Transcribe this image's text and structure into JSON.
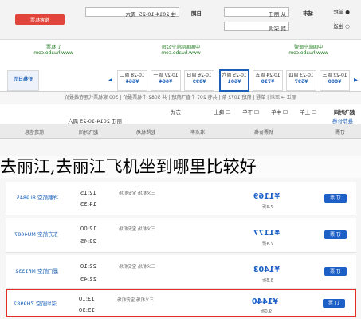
{
  "search": {
    "trip_options": [
      "单程",
      "往返"
    ],
    "from_label": "城市",
    "from_value": "从 丽江",
    "to_value": "到 深圳",
    "date_label": "日期",
    "date_value": "往 2014-10-25",
    "weekday": "周六",
    "cta": "搜索机票"
  },
  "ads": [
    {
      "line1": "中国航空联盟",
      "line2": "www.huabo.com"
    },
    {
      "line1": "中国国际航空公司",
      "line2": "www.huabo.com"
    },
    {
      "line1": "订机票",
      "line2": "www.huabo.com"
    }
  ],
  "date_bar": {
    "cells": [
      {
        "date": "10-22 周三",
        "price": "¥800"
      },
      {
        "date": "10-23 周四",
        "price": "¥597"
      },
      {
        "date": "10-24 周五",
        "price": "¥710"
      },
      {
        "date": "10-25 周六",
        "price": "¥601"
      },
      {
        "date": "10-26 周日",
        "price": "¥999"
      },
      {
        "date": "10-27 周一",
        "price": "¥664"
      },
      {
        "date": "10-28 周二",
        "price": "¥664"
      }
    ],
    "calendar": "价格日历"
  },
  "info_text": "丽江 → 深圳 | 单程 | 航班 1072 条 | 共有 207 个直飞航班 | 共 5082 个机票报价 | 300 家机票代理在线报价",
  "filter": {
    "label": "起飞时间",
    "options": [
      "上午",
      "中午",
      "下午",
      "晚上"
    ],
    "sort": "方式",
    "price_label": "推荐价格",
    "date_note": "丽江 2014-10-25 周六"
  },
  "columns": [
    "航班信息",
    "起飞时间",
    "起降机场",
    "准点率",
    "机票价格",
    "订票"
  ],
  "flights": [
    {
      "airline": "祥鹏航空 8L9845",
      "dep": "12:15",
      "arr": "14:35",
      "airports": "三义机场 宝安机场",
      "price": "¥1169",
      "discount": "7.3折",
      "book": "订 票",
      "highlight": false
    },
    {
      "airline": "东方航空 MU4687",
      "dep": "12:00",
      "arr": "22:45",
      "airports": "三义机场 宝安机场",
      "price": "¥1177",
      "discount": "7.4折",
      "book": "订 票",
      "highlight": false
    },
    {
      "airline": "厦门航空 MF1332",
      "dep": "22:10",
      "arr": "22:45",
      "airports": "三义机场 宝安机场",
      "price": "¥1403",
      "discount": "8.8折",
      "book": "订 票",
      "highlight": false
    },
    {
      "airline": "深圳航空 ZH9982",
      "dep": "13:10",
      "arr": "15:30",
      "airports": "三义机场 宝安机场",
      "price": "¥1440",
      "discount": "9.0折",
      "book": "订 票",
      "highlight": true
    }
  ],
  "overlay_title": "去丽江,去丽江飞机坐到哪里比较好"
}
